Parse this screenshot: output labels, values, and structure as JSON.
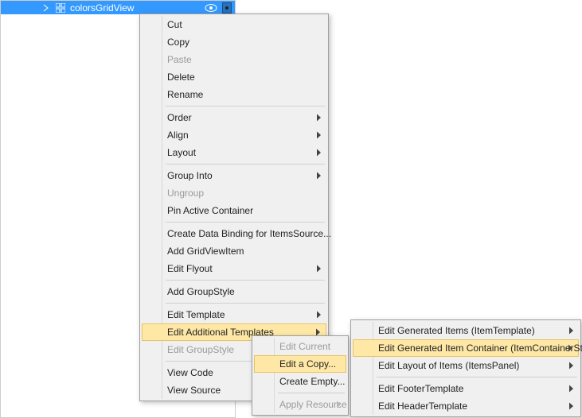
{
  "outline": {
    "node_label": "colorsGridView"
  },
  "main_menu": {
    "cut": "Cut",
    "copy": "Copy",
    "paste": "Paste",
    "delete": "Delete",
    "rename": "Rename",
    "order": "Order",
    "align": "Align",
    "layout": "Layout",
    "group_into": "Group Into",
    "ungroup": "Ungroup",
    "pin": "Pin Active Container",
    "create_binding": "Create Data Binding for ItemsSource...",
    "add_gvitem": "Add GridViewItem",
    "edit_flyout": "Edit Flyout",
    "add_groupstyle": "Add GroupStyle",
    "edit_template": "Edit Template",
    "edit_additional": "Edit Additional Templates",
    "edit_groupstyle": "Edit GroupStyle",
    "view_code": "View Code",
    "view_source": "View Source"
  },
  "edit_menu": {
    "edit_current": "Edit Current",
    "edit_copy": "Edit a Copy...",
    "create_empty": "Create Empty...",
    "apply_resource": "Apply Resource"
  },
  "sub_menu": {
    "gen_items": "Edit Generated Items (ItemTemplate)",
    "gen_container": "Edit Generated Item Container (ItemContainerStyle)",
    "layout_items": "Edit Layout of Items (ItemsPanel)",
    "footer": "Edit FooterTemplate",
    "header": "Edit HeaderTemplate"
  }
}
